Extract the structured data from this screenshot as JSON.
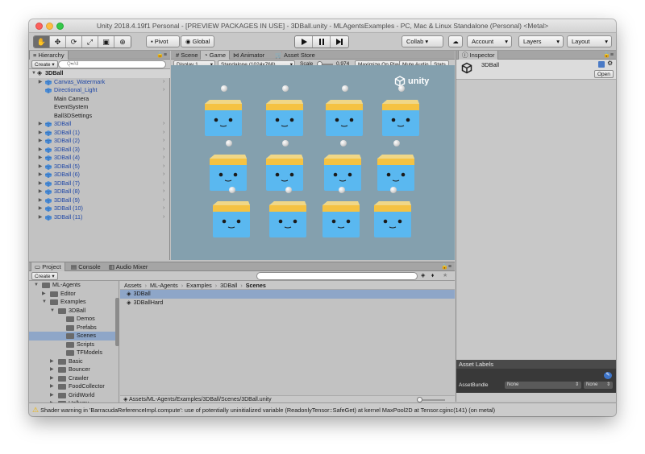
{
  "window": {
    "title": "Unity 2018.4.19f1 Personal - [PREVIEW PACKAGES IN USE] - 3DBall.unity - MLAgentsExamples - PC, Mac & Linux Standalone (Personal) <Metal>"
  },
  "toolbar": {
    "tools": [
      "hand-icon",
      "move-icon",
      "rotate-icon",
      "scale-icon",
      "rect-icon",
      "transform-icon"
    ],
    "pivot": "Pivot",
    "global": "Global",
    "collab": "Collab ▾",
    "account": "Account",
    "layers": "Layers",
    "layout": "Layout"
  },
  "hierarchy": {
    "tab": "Hierarchy",
    "create": "Create ▾",
    "search_placeholder": "Q▾All",
    "scene": "3DBall",
    "items": [
      {
        "label": "Canvas_Watermark",
        "prefab": true,
        "expandable": true
      },
      {
        "label": "Directional_Light",
        "prefab": true,
        "expandable": false
      },
      {
        "label": "Main Camera",
        "prefab": false,
        "expandable": false
      },
      {
        "label": "EventSystem",
        "prefab": false,
        "expandable": false
      },
      {
        "label": "Ball3DSettings",
        "prefab": false,
        "expandable": false
      },
      {
        "label": "3DBall",
        "prefab": true,
        "expandable": true
      },
      {
        "label": "3DBall (1)",
        "prefab": true,
        "expandable": true
      },
      {
        "label": "3DBall (2)",
        "prefab": true,
        "expandable": true
      },
      {
        "label": "3DBall (3)",
        "prefab": true,
        "expandable": true
      },
      {
        "label": "3DBall (4)",
        "prefab": true,
        "expandable": true
      },
      {
        "label": "3DBall (5)",
        "prefab": true,
        "expandable": true
      },
      {
        "label": "3DBall (6)",
        "prefab": true,
        "expandable": true
      },
      {
        "label": "3DBall (7)",
        "prefab": true,
        "expandable": true
      },
      {
        "label": "3DBall (8)",
        "prefab": true,
        "expandable": true
      },
      {
        "label": "3DBall (9)",
        "prefab": true,
        "expandable": true
      },
      {
        "label": "3DBall (10)",
        "prefab": true,
        "expandable": true
      },
      {
        "label": "3DBall (11)",
        "prefab": true,
        "expandable": true
      }
    ]
  },
  "center_tabs": {
    "scene": "Scene",
    "game": "Game",
    "animator": "Animator",
    "asset_store": "Asset Store"
  },
  "game_bar": {
    "display": "Display 1",
    "resolution": "Standalone (1024x768)",
    "scale_label": "Scale",
    "scale_value": "0.974",
    "maximize": "Maximize On Play",
    "mute": "Mute Audio",
    "stats": "Stats",
    "gizmos": "Gizmos ▾"
  },
  "game_view": {
    "logo_text": "unity"
  },
  "inspector": {
    "tab": "Inspector",
    "object": "3DBall",
    "open_button": "Open",
    "asset_labels": "Asset Labels",
    "asset_bundle_label": "AssetBundle",
    "bundle_value": "None",
    "variant_value": "None"
  },
  "bottom_tabs": {
    "project": "Project",
    "console": "Console",
    "audio_mixer": "Audio Mixer"
  },
  "project": {
    "create": "Create ▾",
    "tree": [
      {
        "label": "ML-Agents",
        "depth": 0,
        "expanded": true
      },
      {
        "label": "Editor",
        "depth": 1,
        "expanded": false
      },
      {
        "label": "Examples",
        "depth": 1,
        "expanded": true
      },
      {
        "label": "3DBall",
        "depth": 2,
        "expanded": true
      },
      {
        "label": "Demos",
        "depth": 3,
        "expanded": null
      },
      {
        "label": "Prefabs",
        "depth": 3,
        "expanded": null
      },
      {
        "label": "Scenes",
        "depth": 3,
        "expanded": null,
        "selected": true
      },
      {
        "label": "Scripts",
        "depth": 3,
        "expanded": null
      },
      {
        "label": "TFModels",
        "depth": 3,
        "expanded": null
      },
      {
        "label": "Basic",
        "depth": 2,
        "expanded": false
      },
      {
        "label": "Bouncer",
        "depth": 2,
        "expanded": false
      },
      {
        "label": "Crawler",
        "depth": 2,
        "expanded": false
      },
      {
        "label": "FoodCollector",
        "depth": 2,
        "expanded": false
      },
      {
        "label": "GridWorld",
        "depth": 2,
        "expanded": false
      },
      {
        "label": "Hallway",
        "depth": 2,
        "expanded": false
      }
    ],
    "breadcrumb": [
      "Assets",
      "ML-Agents",
      "Examples",
      "3DBall",
      "Scenes"
    ],
    "files": [
      {
        "label": "3DBall",
        "selected": true
      },
      {
        "label": "3DBallHard",
        "selected": false
      }
    ],
    "path": "Assets/ML-Agents/Examples/3DBall/Scenes/3DBall.unity"
  },
  "status": {
    "message": "Shader warning in 'BarracudaReferenceImpl.compute': use of potentially uninitialized variable (ReadonlyTensor::SafeGet) at kernel MaxPool2D at Tensor.cginc(141) (on metal)"
  },
  "colors": {
    "prefab_text": "#1e46a6",
    "selection": "#8ea6c8",
    "game_bg": "#84a0ae",
    "agent_blue": "#5ab8f0",
    "agent_band": "#f5c242",
    "warning": "#f0b400"
  }
}
